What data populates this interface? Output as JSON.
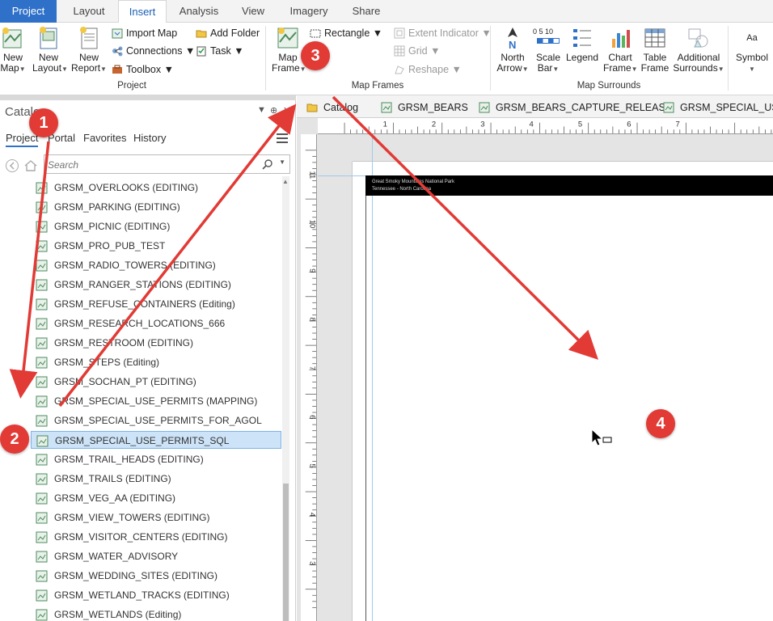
{
  "ribbon_tabs": [
    "Project",
    "Layout",
    "Insert",
    "Analysis",
    "View",
    "Imagery",
    "Share"
  ],
  "active_tab": "Insert",
  "project_group": {
    "label": "Project",
    "new_map": [
      "New",
      "Map"
    ],
    "new_layout": [
      "New",
      "Layout"
    ],
    "new_report": [
      "New",
      "Report"
    ],
    "import_map": "Import Map",
    "add_folder": "Add Folder",
    "connections": "Connections",
    "task": "Task",
    "toolbox": "Toolbox"
  },
  "map_frames_group": {
    "label": "Map Frames",
    "map_frame": [
      "Map",
      "Frame"
    ],
    "rectangle": "Rectangle",
    "extent_indicator": "Extent Indicator",
    "grid": "Grid",
    "reshape": "Reshape"
  },
  "map_surrounds_group": {
    "label": "Map Surrounds",
    "north_arrow": [
      "North",
      "Arrow"
    ],
    "scale_bar": [
      "Scale",
      "Bar"
    ],
    "scale_ticks": "0 5 10",
    "legend": "Legend",
    "chart_frame": [
      "Chart",
      "Frame"
    ],
    "table_frame": [
      "Table",
      "Frame"
    ],
    "additional_surrounds": [
      "Additional",
      "Surrounds"
    ],
    "symbol": "Symbol",
    "symbol_glyph": "Aa"
  },
  "catalog": {
    "title": "Catalog",
    "tabs": [
      "Project",
      "Portal",
      "Favorites",
      "History"
    ],
    "active_tab": "Project",
    "search_placeholder": "Search",
    "items": [
      "GRSM_OVERLOOKS (EDITING)",
      "GRSM_PARKING (EDITING)",
      "GRSM_PICNIC (EDITING)",
      "GRSM_PRO_PUB_TEST",
      "GRSM_RADIO_TOWERS (EDITING)",
      "GRSM_RANGER_STATIONS (EDITING)",
      "GRSM_REFUSE_CONTAINERS (Editing)",
      "GRSM_RESEARCH_LOCATIONS_666",
      "GRSM_RESTROOM (EDITING)",
      "GRSM_STEPS (Editing)",
      "GRSM_SOCHAN_PT (EDITING)",
      "GRSM_SPECIAL_USE_PERMITS (MAPPING)",
      "GRSM_SPECIAL_USE_PERMITS_FOR_AGOL",
      "GRSM_SPECIAL_USE_PERMITS_SQL",
      "GRSM_TRAIL_HEADS (EDITING)",
      "GRSM_TRAILS (EDITING)",
      "GRSM_VEG_AA (EDITING)",
      "GRSM_VIEW_TOWERS (EDITING)",
      "GRSM_VISITOR_CENTERS (EDITING)",
      "GRSM_WATER_ADVISORY",
      "GRSM_WEDDING_SITES (EDITING)",
      "GRSM_WETLAND_TRACKS (EDITING)",
      "GRSM_WETLANDS (Editing)"
    ],
    "selected_item": "GRSM_SPECIAL_USE_PERMITS_SQL"
  },
  "view_tabs": [
    "Catalog",
    "GRSM_BEARS",
    "GRSM_BEARS_CAPTURE_RELEASE",
    "GRSM_SPECIAL_USE_PERMITS"
  ],
  "layout": {
    "ruler_top": [
      "1",
      "2",
      "3",
      "4",
      "5",
      "6",
      "7"
    ],
    "ruler_left": [
      "11",
      "10",
      "9",
      "8",
      "7",
      "6",
      "5",
      "4",
      "3"
    ],
    "banner_line1": "Great Smoky Mountains National Park",
    "banner_line2": "Tennessee - North Carolina"
  },
  "annotations": [
    "1",
    "2",
    "3",
    "4"
  ],
  "colors": {
    "accent": "#2f71c9",
    "annotation": "#e23a35",
    "selection": "#cde3f7"
  }
}
